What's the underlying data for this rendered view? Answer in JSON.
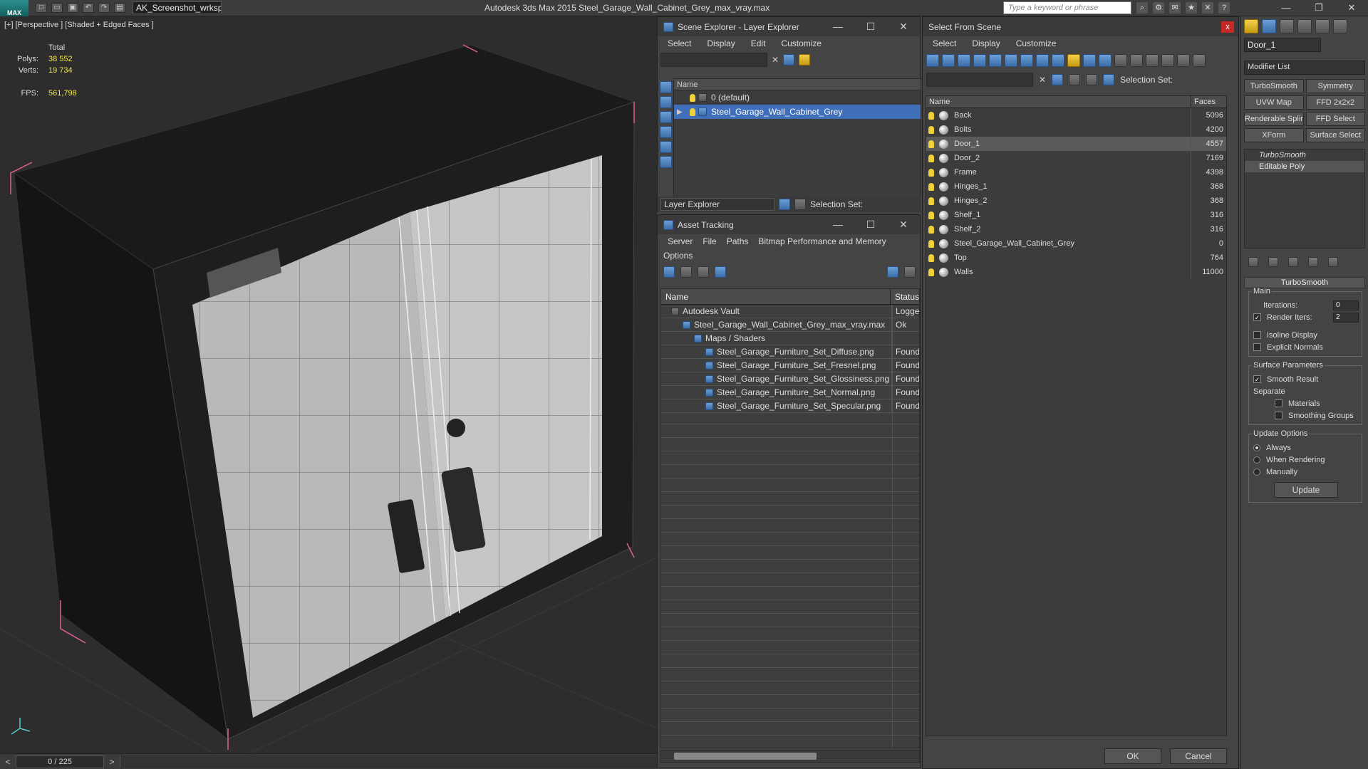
{
  "app": {
    "logo": "MAX",
    "workspace": "AK_Screenshot_wrksp",
    "title": "Autodesk 3ds Max  2015     Steel_Garage_Wall_Cabinet_Grey_max_vray.max",
    "search_placeholder": "Type a keyword or phrase"
  },
  "viewport": {
    "label": "[+] [Perspective ] [Shaded + Edged Faces ]",
    "stats": {
      "total_label": "Total",
      "polys_label": "Polys:",
      "polys": "38 552",
      "verts_label": "Verts:",
      "verts": "19 734",
      "fps_label": "FPS:",
      "fps": "561,798"
    },
    "time_slider": "0 / 225"
  },
  "scene_explorer": {
    "title": "Scene Explorer - Layer Explorer",
    "menu": [
      "Select",
      "Display",
      "Edit",
      "Customize"
    ],
    "column_name": "Name",
    "layers": [
      {
        "name": "0 (default)",
        "selected": false
      },
      {
        "name": "Steel_Garage_Wall_Cabinet_Grey",
        "selected": true
      }
    ],
    "footer_dropdown": "Layer Explorer",
    "selection_set_label": "Selection Set:"
  },
  "asset_tracking": {
    "title": "Asset Tracking",
    "menu": [
      "Server",
      "File",
      "Paths",
      "Bitmap Performance and Memory"
    ],
    "menu2": "Options",
    "columns": {
      "name": "Name",
      "status": "Status"
    },
    "rows": [
      {
        "name": "Autodesk Vault",
        "status": "Logged",
        "indent": 0
      },
      {
        "name": "Steel_Garage_Wall_Cabinet_Grey_max_vray.max",
        "status": "Ok",
        "indent": 1
      },
      {
        "name": "Maps / Shaders",
        "status": "",
        "indent": 2
      },
      {
        "name": "Steel_Garage_Furniture_Set_Diffuse.png",
        "status": "Found",
        "indent": 3
      },
      {
        "name": "Steel_Garage_Furniture_Set_Fresnel.png",
        "status": "Found",
        "indent": 3
      },
      {
        "name": "Steel_Garage_Furniture_Set_Glossiness.png",
        "status": "Found",
        "indent": 3
      },
      {
        "name": "Steel_Garage_Furniture_Set_Normal.png",
        "status": "Found",
        "indent": 3
      },
      {
        "name": "Steel_Garage_Furniture_Set_Specular.png",
        "status": "Found",
        "indent": 3
      }
    ]
  },
  "select_from_scene": {
    "title": "Select From Scene",
    "close": "x",
    "menu": [
      "Select",
      "Display",
      "Customize"
    ],
    "selection_set_label": "Selection Set:",
    "columns": {
      "name": "Name",
      "faces": "Faces"
    },
    "objects": [
      {
        "name": "Back",
        "faces": "5096",
        "selected": false
      },
      {
        "name": "Bolts",
        "faces": "4200",
        "selected": false
      },
      {
        "name": "Door_1",
        "faces": "4557",
        "selected": true
      },
      {
        "name": "Door_2",
        "faces": "7169",
        "selected": false
      },
      {
        "name": "Frame",
        "faces": "4398",
        "selected": false
      },
      {
        "name": "Hinges_1",
        "faces": "368",
        "selected": false
      },
      {
        "name": "Hinges_2",
        "faces": "368",
        "selected": false
      },
      {
        "name": "Shelf_1",
        "faces": "316",
        "selected": false
      },
      {
        "name": "Shelf_2",
        "faces": "316",
        "selected": false
      },
      {
        "name": "Steel_Garage_Wall_Cabinet_Grey",
        "faces": "0",
        "selected": false
      },
      {
        "name": "Top",
        "faces": "764",
        "selected": false
      },
      {
        "name": "Walls",
        "faces": "11000",
        "selected": false
      }
    ],
    "ok": "OK",
    "cancel": "Cancel"
  },
  "command_panel": {
    "object_name": "Door_1",
    "modifier_list": "Modifier List",
    "modifier_buttons": [
      "TurboSmooth",
      "Symmetry",
      "UVW Map",
      "FFD 2x2x2",
      "Renderable Spline",
      "FFD Select",
      "XForm",
      "Surface Select"
    ],
    "stack": [
      "TurboSmooth",
      "Editable Poly"
    ],
    "rollout_title": "TurboSmooth",
    "main_label": "Main",
    "iterations_label": "Iterations:",
    "iterations": "0",
    "render_iters_label": "Render Iters:",
    "render_iters": "2",
    "isoline_label": "Isoline Display",
    "explicit_normals_label": "Explicit Normals",
    "surface_params_label": "Surface Parameters",
    "smooth_result_label": "Smooth Result",
    "separate_label": "Separate",
    "materials_label": "Materials",
    "smoothing_groups_label": "Smoothing Groups",
    "update_options_label": "Update Options",
    "always_label": "Always",
    "when_rendering_label": "When Rendering",
    "manually_label": "Manually",
    "update_button": "Update"
  }
}
